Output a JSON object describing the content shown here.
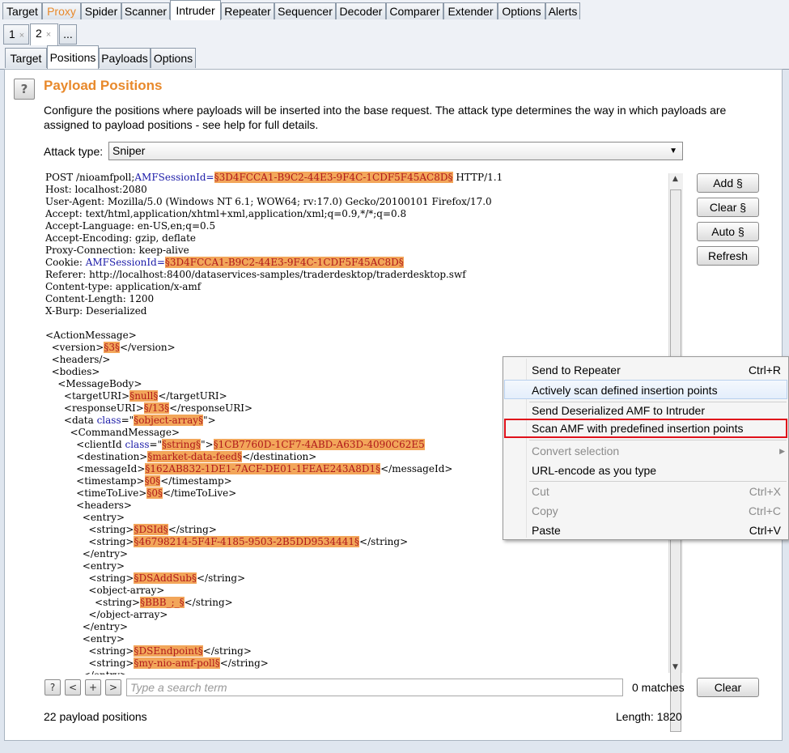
{
  "top_tabs": [
    "Target",
    "Proxy",
    "Spider",
    "Scanner",
    "Intruder",
    "Repeater",
    "Sequencer",
    "Decoder",
    "Comparer",
    "Extender",
    "Options",
    "Alerts"
  ],
  "attack_tabs": {
    "tab1": "1",
    "tab2": "2",
    "close": "×",
    "more": "..."
  },
  "sub_tabs": [
    "Target",
    "Positions",
    "Payloads",
    "Options"
  ],
  "panel": {
    "help": "?",
    "title": "Payload Positions",
    "description": "Configure the positions where payloads will be inserted into the base request. The attack type determines the way in which payloads are assigned to payload positions - see help for full details.",
    "attack_type_label": "Attack type:",
    "attack_type_value": "Sniper"
  },
  "buttons": {
    "add": "Add §",
    "clear": "Clear §",
    "auto": "Auto §",
    "refresh": "Refresh"
  },
  "request_lines": [
    [
      {
        "t": "POST /nioamfpoll;"
      },
      {
        "t": "AMFSessionId=",
        "c": "kw"
      },
      {
        "t": "§3D4FCCA1-B9C2-44E3-9F4C-1CDF5F45AC8D§",
        "c": "m"
      },
      {
        "t": " HTTP/1.1"
      }
    ],
    [
      {
        "t": "Host: localhost:2080"
      }
    ],
    [
      {
        "t": "User-Agent: Mozilla/5.0 (Windows NT 6.1; WOW64; rv:17.0) Gecko/20100101 Firefox/17.0"
      }
    ],
    [
      {
        "t": "Accept: text/html,application/xhtml+xml,application/xml;q=0.9,*/*;q=0.8"
      }
    ],
    [
      {
        "t": "Accept-Language: en-US,en;q=0.5"
      }
    ],
    [
      {
        "t": "Accept-Encoding: gzip, deflate"
      }
    ],
    [
      {
        "t": "Proxy-Connection: keep-alive"
      }
    ],
    [
      {
        "t": "Cookie: "
      },
      {
        "t": "AMFSessionId=",
        "c": "kw"
      },
      {
        "t": "§3D4FCCA1-B9C2-44E3-9F4C-1CDF5F45AC8D§",
        "c": "m"
      }
    ],
    [
      {
        "t": "Referer: http://localhost:8400/dataservices-samples/traderdesktop/traderdesktop.swf"
      }
    ],
    [
      {
        "t": "Content-type: application/x-amf"
      }
    ],
    [
      {
        "t": "Content-Length: 1200"
      }
    ],
    [
      {
        "t": "X-Burp: Deserialized"
      }
    ],
    [
      {
        "t": ""
      }
    ],
    [
      {
        "t": "<ActionMessage>"
      }
    ],
    [
      {
        "t": "  <version>"
      },
      {
        "t": "§3§",
        "c": "m"
      },
      {
        "t": "</version>"
      }
    ],
    [
      {
        "t": "  <headers/>"
      }
    ],
    [
      {
        "t": "  <bodies>"
      }
    ],
    [
      {
        "t": "    <MessageBody>"
      }
    ],
    [
      {
        "t": "      <targetURI>"
      },
      {
        "t": "§null§",
        "c": "m"
      },
      {
        "t": "</targetURI>"
      }
    ],
    [
      {
        "t": "      <responseURI>"
      },
      {
        "t": "§/13§",
        "c": "m"
      },
      {
        "t": "</responseURI>"
      }
    ],
    [
      {
        "t": "      <data "
      },
      {
        "t": "class",
        "c": "kw"
      },
      {
        "t": "=\""
      },
      {
        "t": "§object-array§",
        "c": "m"
      },
      {
        "t": "\">"
      }
    ],
    [
      {
        "t": "        <CommandMessage>"
      }
    ],
    [
      {
        "t": "          <clientId "
      },
      {
        "t": "class",
        "c": "kw"
      },
      {
        "t": "=\""
      },
      {
        "t": "§string§",
        "c": "m"
      },
      {
        "t": "\">"
      },
      {
        "t": "§1CB7760D-1CF7-4ABD-A63D-4090C62E5",
        "c": "m"
      }
    ],
    [
      {
        "t": "          <destination>"
      },
      {
        "t": "§market-data-feed§",
        "c": "m"
      },
      {
        "t": "</destination>"
      }
    ],
    [
      {
        "t": "          <messageId>"
      },
      {
        "t": "§162AB832-1DE1-7ACF-DE01-1FEAE243A8D1§",
        "c": "m"
      },
      {
        "t": "</messageId>"
      }
    ],
    [
      {
        "t": "          <timestamp>"
      },
      {
        "t": "§0§",
        "c": "m"
      },
      {
        "t": "</timestamp>"
      }
    ],
    [
      {
        "t": "          <timeToLive>"
      },
      {
        "t": "§0§",
        "c": "m"
      },
      {
        "t": "</timeToLive>"
      }
    ],
    [
      {
        "t": "          <headers>"
      }
    ],
    [
      {
        "t": "            <entry>"
      }
    ],
    [
      {
        "t": "              <string>"
      },
      {
        "t": "§DSId§",
        "c": "m"
      },
      {
        "t": "</string>"
      }
    ],
    [
      {
        "t": "              <string>"
      },
      {
        "t": "§46798214-5F4F-4185-9503-2B5DD9534441§",
        "c": "m"
      },
      {
        "t": "</string>"
      }
    ],
    [
      {
        "t": "            </entry>"
      }
    ],
    [
      {
        "t": "            <entry>"
      }
    ],
    [
      {
        "t": "              <string>"
      },
      {
        "t": "§DSAddSub§",
        "c": "m"
      },
      {
        "t": "</string>"
      }
    ],
    [
      {
        "t": "              <object-array>"
      }
    ],
    [
      {
        "t": "                <string>"
      },
      {
        "t": "§BBB_;_§",
        "c": "m"
      },
      {
        "t": "</string>"
      }
    ],
    [
      {
        "t": "              </object-array>"
      }
    ],
    [
      {
        "t": "            </entry>"
      }
    ],
    [
      {
        "t": "            <entry>"
      }
    ],
    [
      {
        "t": "              <string>"
      },
      {
        "t": "§DSEndpoint§",
        "c": "m"
      },
      {
        "t": "</string>"
      }
    ],
    [
      {
        "t": "              <string>"
      },
      {
        "t": "§my-nio-amf-poll§",
        "c": "m"
      },
      {
        "t": "</string>"
      }
    ],
    [
      {
        "t": "            </entry>"
      }
    ]
  ],
  "search": {
    "help": "?",
    "prev": "<",
    "add": "+",
    "next": ">",
    "placeholder": "Type a search term",
    "matches": "0 matches",
    "clear": "Clear"
  },
  "footer": {
    "positions": "22 payload positions",
    "length": "Length: 1820"
  },
  "context_menu": [
    {
      "label": "Send to Repeater",
      "shortcut": "Ctrl+R"
    },
    {
      "label": "Actively scan defined insertion points",
      "shortcut": ""
    },
    {
      "label": "Send Deserialized AMF to Intruder",
      "shortcut": ""
    },
    {
      "label": "Scan AMF with predefined insertion points",
      "shortcut": ""
    },
    {
      "label": "Convert selection",
      "shortcut": ""
    },
    {
      "label": "URL-encode as you type",
      "shortcut": ""
    },
    {
      "label": "Cut",
      "shortcut": "Ctrl+X"
    },
    {
      "label": "Copy",
      "shortcut": "Ctrl+C"
    },
    {
      "label": "Paste",
      "shortcut": "Ctrl+V"
    }
  ],
  "colors": {
    "accent": "#e8892b",
    "marker_bg": "#f2a65a",
    "marker_text": "#b0181a",
    "highlight_box": "#e0101a"
  }
}
